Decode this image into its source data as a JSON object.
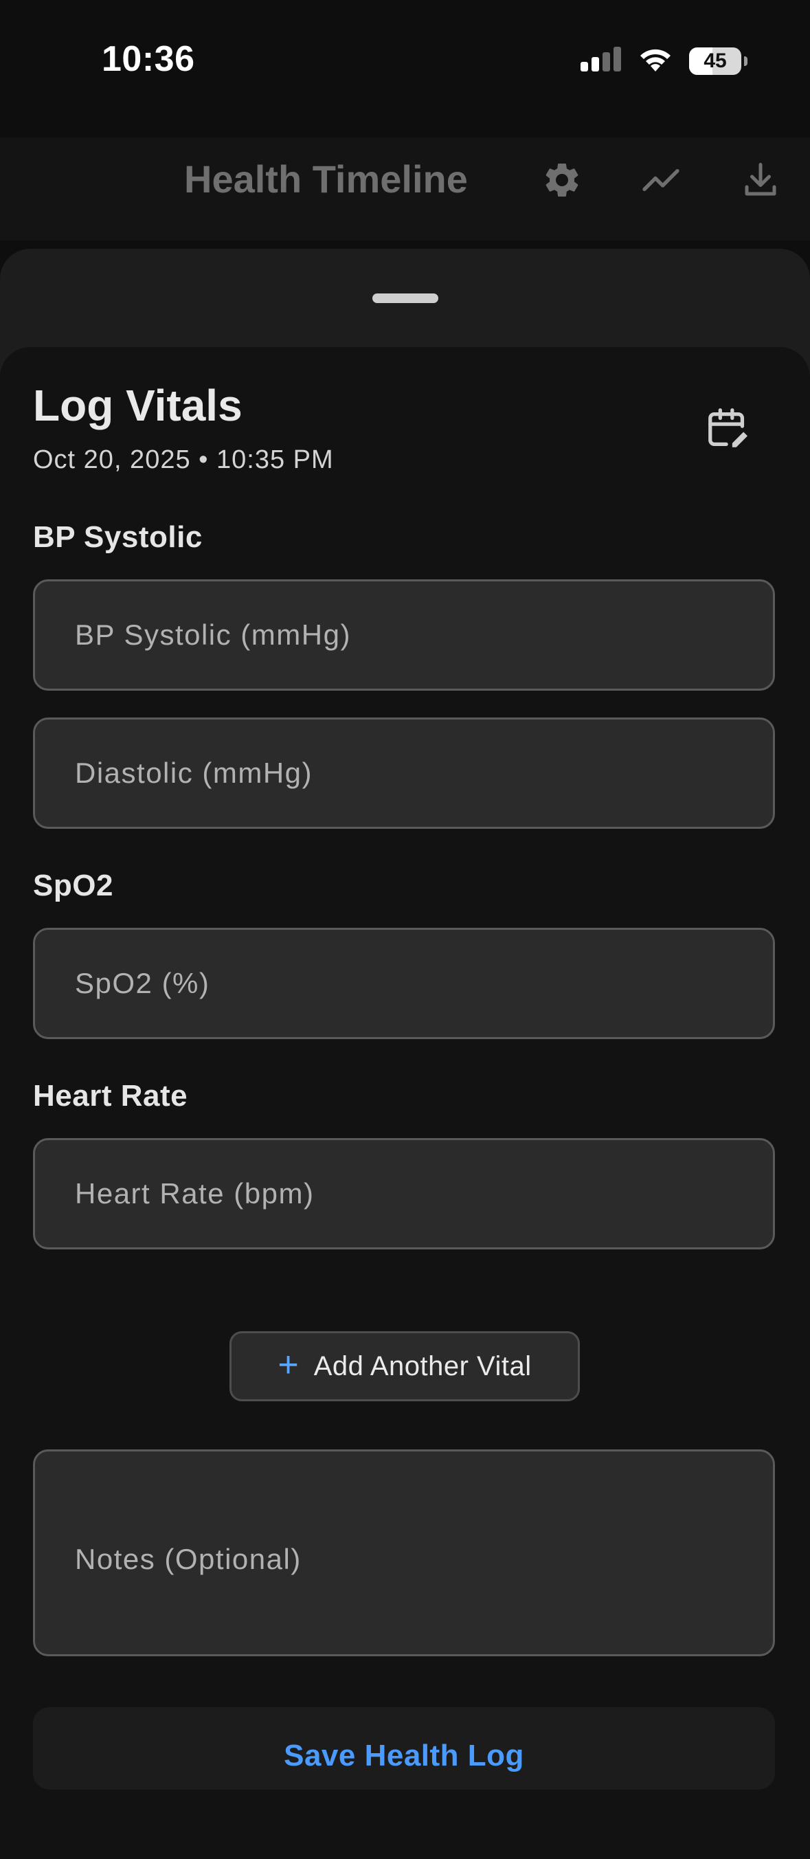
{
  "status_bar": {
    "time": "10:36",
    "battery_level": "45",
    "battery_fraction": 0.45
  },
  "header": {
    "title": "Health Timeline",
    "icons": [
      "gear-icon",
      "trend-line-icon",
      "download-icon"
    ]
  },
  "sheet": {
    "title": "Log Vitals",
    "datetime": "Oct 20, 2025 • 10:35 PM",
    "calendar_icon": "calendar-edit-icon"
  },
  "vitals": {
    "bp_label": "BP Systolic",
    "bp_systolic": {
      "value": "",
      "placeholder": "BP Systolic (mmHg)"
    },
    "bp_diastolic": {
      "value": "",
      "placeholder": "Diastolic (mmHg)"
    },
    "spo2_label": "SpO2",
    "spo2": {
      "value": "",
      "placeholder": "SpO2 (%)"
    },
    "hr_label": "Heart Rate",
    "heart_rate": {
      "value": "",
      "placeholder": "Heart Rate (bpm)"
    }
  },
  "actions": {
    "add_vital_label": "Add Another Vital",
    "save_label": "Save Health Log"
  },
  "notes": {
    "value": "",
    "placeholder": "Notes (Optional)"
  },
  "colors": {
    "accent": "#4b9bff",
    "background": "#121212",
    "field_bg": "#2b2b2b",
    "field_border": "#5a5a5a"
  }
}
